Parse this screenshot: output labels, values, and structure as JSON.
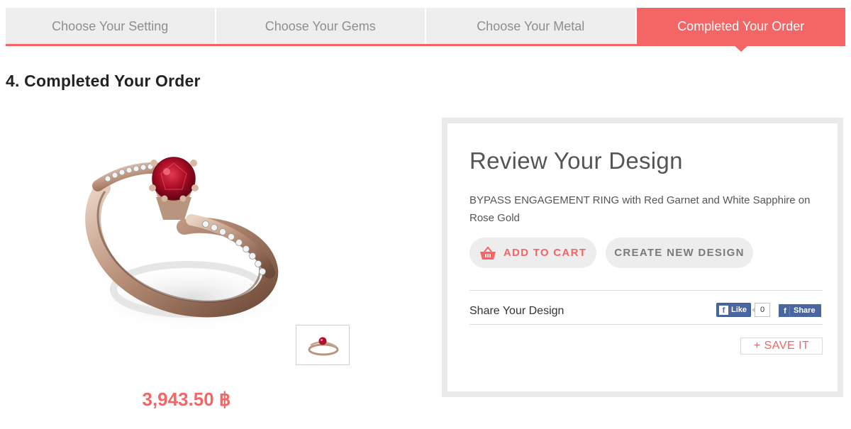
{
  "steps": [
    {
      "label": "Choose Your Setting",
      "active": false
    },
    {
      "label": "Choose Your Gems",
      "active": false
    },
    {
      "label": "Choose Your Metal",
      "active": false
    },
    {
      "label": "Completed Your Order",
      "active": true
    }
  ],
  "page_title": "4. Completed Your Order",
  "product": {
    "price": "3,943.50 ฿"
  },
  "review": {
    "title": "Review Your Design",
    "description": "BYPASS ENGAGEMENT RING with Red Garnet and White Sapphire on Rose Gold",
    "add_to_cart_label": "ADD TO CART",
    "create_new_label": "CREATE NEW DESIGN",
    "share_label": "Share Your Design",
    "fb_like_label": "Like",
    "fb_like_count": "0",
    "fb_share_label": "Share",
    "save_label": "+ SAVE IT"
  },
  "colors": {
    "accent": "#f46566",
    "tab_bg": "#eeeeee",
    "facebook": "#4a66a0",
    "rose_gold": "#c9a88f",
    "garnet": "#b0102a"
  },
  "icons": {
    "cart": "basket-icon",
    "facebook": "facebook-icon"
  }
}
